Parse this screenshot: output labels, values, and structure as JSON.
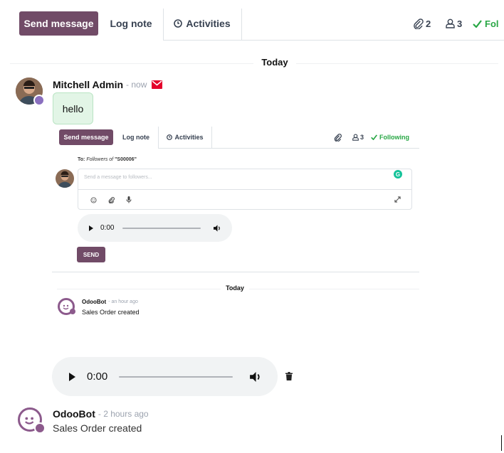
{
  "toolbar": {
    "send_message": "Send message",
    "log_note": "Log note",
    "activities": "Activities",
    "attachments_count": "2",
    "followers_count": "3",
    "follow_label": "Fol"
  },
  "date_separator": "Today",
  "message": {
    "author": "Mitchell Admin",
    "time": "- now",
    "body": "hello"
  },
  "embedded": {
    "send_message": "Send message",
    "log_note": "Log note",
    "activities": "Activities",
    "followers_count": "3",
    "following_label": "Following",
    "to_prefix": "To:",
    "to_followers": "Followers of",
    "to_record": "\"S00006\"",
    "composer_placeholder": "Send a message to followers...",
    "audio_time": "0:00",
    "send_label": "SEND",
    "date_separator": "Today",
    "bot_author": "OdooBot",
    "bot_time": "- an hour ago",
    "bot_body": "Sales Order created"
  },
  "audio": {
    "time": "0:00"
  },
  "bottom_message": {
    "author": "OdooBot",
    "time": "- 2 hours ago",
    "body": "Sales Order created"
  },
  "colors": {
    "primary": "#714B67",
    "following": "#28a745",
    "bubble": "#e2f5e6",
    "unread_envelope": "#e4002b"
  }
}
